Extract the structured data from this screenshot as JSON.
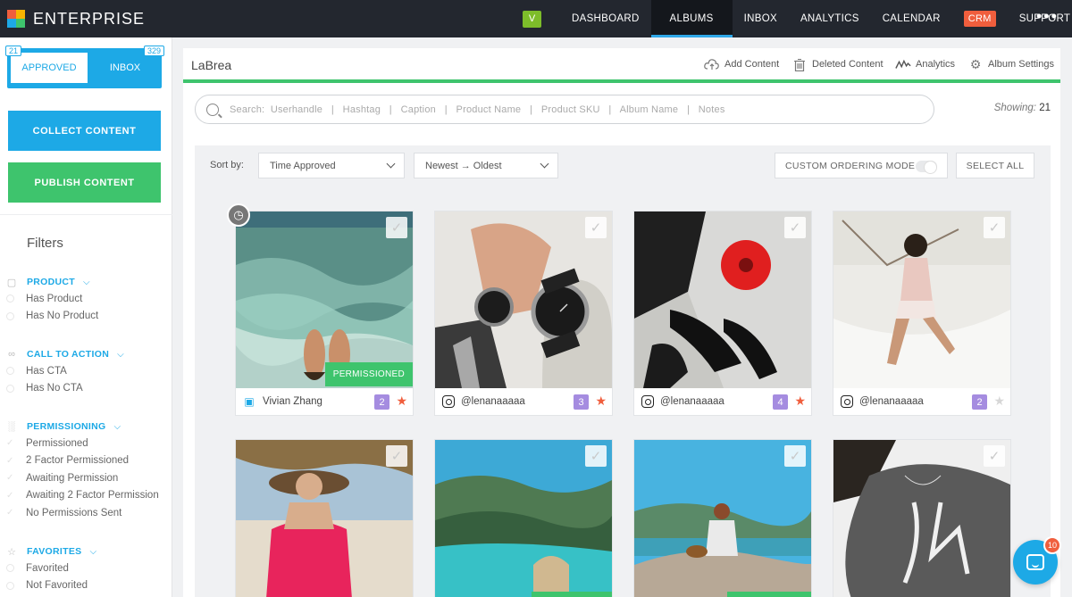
{
  "brand": {
    "name": "ENTERPRISE",
    "colors": {
      "accent": "#1da9e6",
      "success": "#3ec46d",
      "nav_bg": "#23272f",
      "crm": "#f05e3d",
      "badge": "#a58ce0"
    }
  },
  "topnav": {
    "v_badge": "V",
    "items": [
      {
        "label": "DASHBOARD"
      },
      {
        "label": "ALBUMS",
        "active": true
      },
      {
        "label": "INBOX"
      },
      {
        "label": "ANALYTICS"
      },
      {
        "label": "CALENDAR"
      },
      {
        "label": "CRM"
      },
      {
        "label": "SUPPORT"
      }
    ],
    "more": "•••"
  },
  "sidebar": {
    "tabs": {
      "approved_label": "APPROVED",
      "approved_count": "21",
      "inbox_label": "INBOX",
      "inbox_count": "329"
    },
    "collect_label": "COLLECT CONTENT",
    "publish_label": "PUBLISH CONTENT",
    "filters_title": "Filters",
    "groups": [
      {
        "label": "PRODUCT",
        "icon": "product-icon",
        "options": [
          "Has Product",
          "Has No Product"
        ]
      },
      {
        "label": "CALL TO ACTION",
        "icon": "link-icon",
        "options": [
          "Has CTA",
          "Has No CTA"
        ]
      },
      {
        "label": "PERMISSIONING",
        "icon": "lock-icon",
        "options": [
          "Permissioned",
          "2 Factor Permissioned",
          "Awaiting Permission",
          "Awaiting 2 Factor Permission",
          "No Permissions Sent"
        ]
      },
      {
        "label": "FAVORITES",
        "icon": "star-icon",
        "options": [
          "Favorited",
          "Not Favorited"
        ]
      }
    ]
  },
  "album": {
    "title": "LaBrea",
    "actions": {
      "add": "Add Content",
      "deleted": "Deleted Content",
      "analytics": "Analytics",
      "settings": "Album Settings"
    }
  },
  "search": {
    "placeholder": "Search:  Userhandle   |   Hashtag   |   Caption   |   Product Name   |   Product SKU   |   Album Name   |   Notes",
    "showing_label": "Showing:",
    "showing_count": "21"
  },
  "sortbar": {
    "sort_label": "Sort by:",
    "sort_field": "Time Approved",
    "sort_order": "Newest → Oldest",
    "custom_mode": "CUSTOM ORDERING MODE",
    "select_all": "SELECT ALL"
  },
  "cards": [
    {
      "user": "Vivian Zhang",
      "source": "laptop-icon",
      "count": "2",
      "favorited": true,
      "badge": "PERMISSIONED",
      "photo": "ocean-feet"
    },
    {
      "user": "@lenanaaaaa",
      "source": "instagram-icon",
      "count": "3",
      "favorited": true,
      "photo": "watches"
    },
    {
      "user": "@lenanaaaaa",
      "source": "instagram-icon",
      "count": "4",
      "favorited": true,
      "photo": "red-flower-heels"
    },
    {
      "user": "@lenanaaaaa",
      "source": "instagram-icon",
      "count": "2",
      "favorited": false,
      "photo": "hammock"
    },
    {
      "photo": "beach-hat"
    },
    {
      "photo": "mountain-lake"
    },
    {
      "photo": "dog-cliff"
    },
    {
      "photo": "sleepy-shirt"
    }
  ],
  "chat": {
    "unread": "10"
  }
}
